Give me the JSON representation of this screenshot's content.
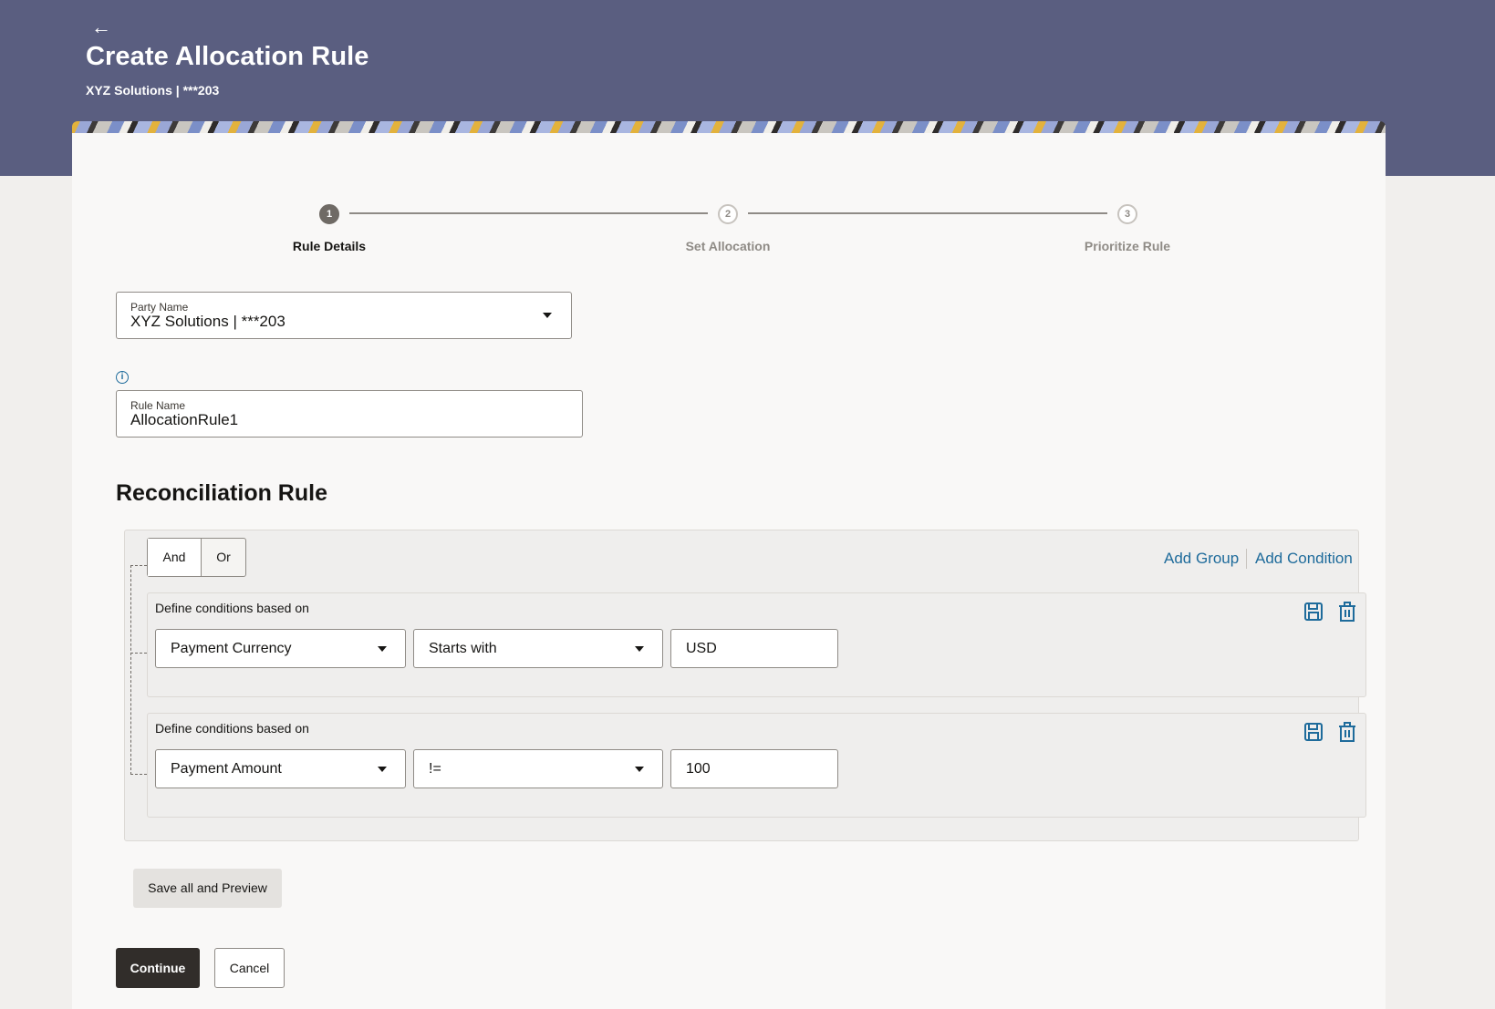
{
  "header": {
    "back_icon": "arrow-left-icon",
    "title": "Create Allocation Rule",
    "subtitle": "XYZ Solutions | ***203"
  },
  "stepper": {
    "steps": [
      {
        "number": "1",
        "label": "Rule Details",
        "state": "active"
      },
      {
        "number": "2",
        "label": "Set Allocation",
        "state": "todo"
      },
      {
        "number": "3",
        "label": "Prioritize Rule",
        "state": "todo"
      }
    ]
  },
  "form": {
    "party_name": {
      "label": "Party Name",
      "value": "XYZ Solutions | ***203"
    },
    "rule_name": {
      "label": "Rule Name",
      "value": "AllocationRule1"
    },
    "info_icon": "info-icon"
  },
  "reconciliation": {
    "title": "Reconciliation Rule",
    "toggle": {
      "and": "And",
      "or": "Or",
      "selected": "And"
    },
    "add_group": "Add Group",
    "add_condition": "Add Condition",
    "conditions": [
      {
        "label": "Define conditions based on",
        "field": "Payment Currency",
        "operator": "Starts with",
        "value": "USD"
      },
      {
        "label": "Define conditions based on",
        "field": "Payment Amount",
        "operator": "!=",
        "value": "100"
      }
    ]
  },
  "actions": {
    "save_preview": "Save all and Preview",
    "continue": "Continue",
    "cancel": "Cancel"
  },
  "colors": {
    "header_band": "#5a5e80",
    "accent_link": "#1e6b9b",
    "primary_button": "#312d2a"
  }
}
